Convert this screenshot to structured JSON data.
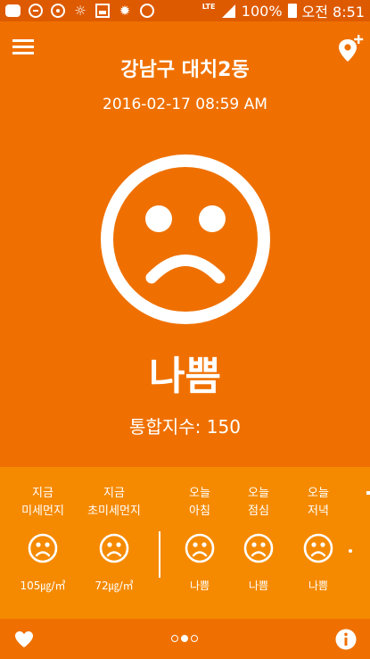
{
  "status_bar": {
    "battery_text": "100%",
    "time": "오전 8:51",
    "network": "LTE",
    "icons": [
      "message-icon",
      "do-not-disturb-icon",
      "sync-icon",
      "brightness-icon",
      "image-icon",
      "sun-icon",
      "dust-icon",
      "lte-icon",
      "signal-icon",
      "battery-icon"
    ]
  },
  "header": {
    "location": "강남구 대치2동",
    "datetime": "2016-02-17 08:59 AM",
    "menu_icon": "menu-icon",
    "add_location_icon": "add-location-icon"
  },
  "current": {
    "status": "나쁨",
    "index_label": "통합지수:",
    "index_value": "150",
    "face": "sad-face"
  },
  "forecast": [
    {
      "line1": "지금",
      "line2": "미세먼지",
      "value": "105㎍/㎥",
      "face": "sad-face"
    },
    {
      "line1": "지금",
      "line2": "초미세먼지",
      "value": "72㎍/㎥",
      "face": "sad-face"
    },
    {
      "line1": "오늘",
      "line2": "아침",
      "value": "나쁨",
      "face": "sad-face"
    },
    {
      "line1": "오늘",
      "line2": "점심",
      "value": "나쁨",
      "face": "sad-face"
    },
    {
      "line1": "오늘",
      "line2": "저녁",
      "value": "나쁨",
      "face": "sad-face"
    }
  ],
  "bottom_bar": {
    "favorite_icon": "heart-icon",
    "info_icon": "info-icon",
    "page_count": 3,
    "active_page": 1
  },
  "colors": {
    "background": "#ef7000",
    "status_bar": "#de5a00",
    "forecast_panel": "#f58a00",
    "foreground": "#ffffff"
  }
}
